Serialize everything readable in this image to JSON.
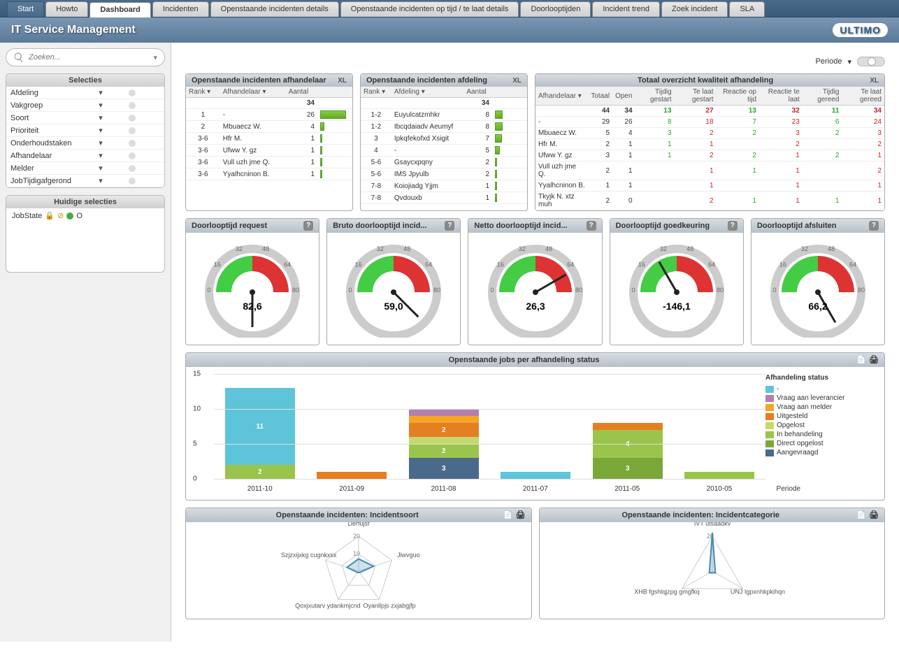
{
  "tabs": [
    "Start",
    "Howto",
    "Dashboard",
    "Incidenten",
    "Openstaande incidenten details",
    "Openstaande incidenten op tijd / te laat details",
    "Doorlooptijden",
    "Incident trend",
    "Zoek incident",
    "SLA"
  ],
  "active_tab": "Dashboard",
  "app_title": "IT Service Management",
  "logo": "ULTIMO",
  "search_placeholder": "Zoeken...",
  "period_label": "Periode",
  "sidebar": {
    "selecties_hdr": "Selecties",
    "items": [
      "Afdeling",
      "Vakgroep",
      "Soort",
      "Prioriteit",
      "Onderhoudstaken",
      "Afhandelaar",
      "Melder",
      "JobTijdigafgerond"
    ],
    "huidige_hdr": "Huidige selecties",
    "jobstate_label": "JobState",
    "jobstate_val": "O"
  },
  "w1": {
    "title": "Openstaande incidenten afhandelaar",
    "cols": [
      "Rank",
      "Afhandelaar",
      "Aantal"
    ],
    "total": 34,
    "rows": [
      {
        "rank": "1",
        "name": "-",
        "val": 26
      },
      {
        "rank": "2",
        "name": "Mbuaecz W.",
        "val": 4
      },
      {
        "rank": "3-6",
        "name": "Hfr M.",
        "val": 1
      },
      {
        "rank": "3-6",
        "name": "Ufww Y. gz",
        "val": 1
      },
      {
        "rank": "3-6",
        "name": "Vull uzh jme Q.",
        "val": 1
      },
      {
        "rank": "3-6",
        "name": "Yyalhcninon B.",
        "val": 1
      }
    ]
  },
  "w2": {
    "title": "Openstaande incidenten afdeling",
    "cols": [
      "Rank",
      "Afdeling",
      "Aantal"
    ],
    "total": 34,
    "rows": [
      {
        "rank": "1-2",
        "name": "Euyulcatzmhkr",
        "val": 8
      },
      {
        "rank": "1-2",
        "name": "Ibcqdaiadv Aeumyf",
        "val": 8
      },
      {
        "rank": "3",
        "name": "Ipkqfekofxd Xsigit",
        "val": 7
      },
      {
        "rank": "4",
        "name": "-",
        "val": 5
      },
      {
        "rank": "5-6",
        "name": "Gsaycxpqny",
        "val": 2
      },
      {
        "rank": "5-6",
        "name": "IMS Jpyulb",
        "val": 2
      },
      {
        "rank": "7-8",
        "name": "Koiojiadg Yjjm",
        "val": 1
      },
      {
        "rank": "7-8",
        "name": "Qvdouxb",
        "val": 1
      }
    ]
  },
  "w3": {
    "title": "Totaal overzicht kwaliteit afhandeling",
    "cols": [
      "Afhandelaar",
      "Totaal",
      "Open",
      "Tijdig gestart",
      "Te laat gestart",
      "Reactie op tijd",
      "Reactie te laat",
      "Tijdig gereed",
      "Te laat gereed"
    ],
    "totals": [
      "",
      "44",
      "34",
      "13",
      "27",
      "13",
      "32",
      "11",
      "34"
    ],
    "rows": [
      [
        "-",
        "29",
        "26",
        "8",
        "18",
        "7",
        "23",
        "6",
        "24"
      ],
      [
        "Mbuaecz W.",
        "5",
        "4",
        "3",
        "2",
        "2",
        "3",
        "2",
        "3"
      ],
      [
        "Hfr M.",
        "2",
        "1",
        "1",
        "1",
        "",
        "2",
        "",
        "2"
      ],
      [
        "Ufww Y. gz",
        "3",
        "1",
        "1",
        "2",
        "2",
        "1",
        "2",
        "1"
      ],
      [
        "Vull uzh jme Q.",
        "2",
        "1",
        "",
        "1",
        "1",
        "1",
        "",
        "2"
      ],
      [
        "Yyalhcninon B.",
        "1",
        "1",
        "",
        "1",
        "",
        "1",
        "",
        "1"
      ],
      [
        "Tkyjk N. xtz muh",
        "2",
        "0",
        "",
        "2",
        "1",
        "1",
        "1",
        "1"
      ]
    ]
  },
  "gauges": [
    {
      "title": "Doorlooptijd request",
      "val": "82,6",
      "angle": 180
    },
    {
      "title": "Bruto doorlooptijd incid...",
      "val": "59,0",
      "angle": 135
    },
    {
      "title": "Netto doorlooptijd incid...",
      "val": "26,3",
      "angle": 60
    },
    {
      "title": "Doorlooptijd goedkeuring",
      "val": "-146,1",
      "angle": -30
    },
    {
      "title": "Doorlooptijd afsluiten",
      "val": "66,2",
      "angle": 150
    }
  ],
  "gauge_ticks": [
    "0",
    "16",
    "32",
    "48",
    "64",
    "80"
  ],
  "chart_data": {
    "bar": {
      "title": "Openstaande jobs per afhandeling status",
      "type": "bar",
      "ymax": 15,
      "yticks": [
        0,
        5,
        10,
        15
      ],
      "xlabel": "Periode",
      "categories": [
        "2011-10",
        "2011-09",
        "2011-08",
        "2011-07",
        "2011-05",
        "2010-05"
      ],
      "legend_title": "Afhandeling status",
      "series": [
        {
          "name": "-",
          "color": "#5ec4d9",
          "values": [
            11,
            0,
            0,
            1,
            0,
            0
          ]
        },
        {
          "name": "Vraag aan leverancier",
          "color": "#b47fb0",
          "values": [
            0,
            0,
            1,
            0,
            0,
            0
          ]
        },
        {
          "name": "Vraag aan melder",
          "color": "#f5a623",
          "values": [
            0,
            0,
            1,
            0,
            0,
            0
          ]
        },
        {
          "name": "Uitgesteld",
          "color": "#e67e22",
          "values": [
            0,
            1,
            2,
            0,
            1,
            0
          ]
        },
        {
          "name": "Opgelost",
          "color": "#c5d86d",
          "values": [
            0,
            0,
            1,
            0,
            0,
            0
          ]
        },
        {
          "name": "In behandeling",
          "color": "#9ac44c",
          "values": [
            2,
            0,
            2,
            0,
            4,
            1
          ]
        },
        {
          "name": "Direct opgelost",
          "color": "#7aa838",
          "values": [
            0,
            0,
            0,
            0,
            3,
            0
          ]
        },
        {
          "name": "Aangevraagd",
          "color": "#4a6a8a",
          "values": [
            0,
            0,
            3,
            0,
            0,
            0
          ]
        }
      ]
    },
    "radar1": {
      "title": "Openstaande incidenten: Incidentsoort",
      "type": "radar",
      "ticks": [
        10,
        20
      ],
      "axes": [
        "Derfujsf",
        "Jlwvguo",
        "Oyanllpjs zxjabgjfp",
        "Qoxjxutarv ydankmjcnd",
        "Szjzxijxkg cugnkxsx"
      ],
      "values": [
        7,
        9,
        1,
        1,
        7
      ]
    },
    "radar2": {
      "title": "Openstaande incidenten: Incidentcategorie",
      "type": "radar",
      "ticks": [
        20
      ],
      "axes": [
        "IVT utsaadkv",
        "UNJ Igpxnhkpkihqn",
        "XHB fgshlqjzpg gmgfkq"
      ],
      "values": [
        22,
        2,
        2
      ]
    }
  }
}
